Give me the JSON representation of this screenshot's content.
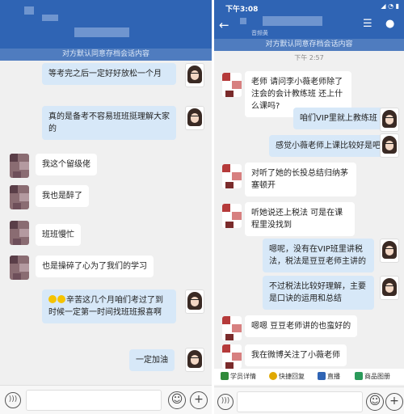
{
  "left": {
    "notice": "对方默认同意存档会话内容",
    "messages": [
      {
        "side": "out",
        "text": "等考完之后一定好好放松一个月"
      },
      {
        "side": "out",
        "text": "真的是备考不容易班班挺理解大家的"
      },
      {
        "side": "in",
        "text": "我这个留级佬"
      },
      {
        "side": "in",
        "text": "我也是醉了"
      },
      {
        "side": "in",
        "text": "班班慢忙"
      },
      {
        "side": "in",
        "text": "也是操碎了心为了我们的学习"
      },
      {
        "side": "out",
        "text": "辛苦这几个月咱们考过了到时候一定第一时间找班班报喜啊"
      },
      {
        "side": "out",
        "text": "一定加油"
      }
    ]
  },
  "right": {
    "status_time": "下午3:08",
    "header_subtitle": "音频黄",
    "notice": "对方默认同意存档会话内容",
    "timestamp": "下午 2:57",
    "messages": [
      {
        "side": "in",
        "text": "老师 请问李小薇老师除了注会的会计教练班 还上什么课吗?"
      },
      {
        "side": "out",
        "text": "咱们VIP里就上教练班"
      },
      {
        "side": "out",
        "text": "感觉小薇老师上课比较好是吧"
      },
      {
        "side": "in",
        "text": "对听了她的长投总结归纳茅塞顿开"
      },
      {
        "side": "in",
        "text": "听她说还上税法 可是在课程里没找到"
      },
      {
        "side": "out",
        "text": "嗯呢，没有在VIP班里讲税法，税法是豆豆老师主讲的"
      },
      {
        "side": "out",
        "text": "不过税法比较好理解，主要是口诀的运用和总结"
      },
      {
        "side": "in",
        "text": "嗯嗯 豆豆老师讲的也蛮好的"
      },
      {
        "side": "in",
        "text": "我在微博关注了小薇老师"
      }
    ],
    "quick_actions": [
      {
        "label": "学员详情",
        "icon": "student-icon",
        "color": "#2f8a3a"
      },
      {
        "label": "快捷回复",
        "icon": "reply-icon",
        "color": "#e0a800"
      },
      {
        "label": "直播",
        "icon": "live-icon",
        "color": "#2f64b4"
      },
      {
        "label": "商品图册",
        "icon": "goods-icon",
        "color": "#2a9a5a"
      }
    ]
  }
}
